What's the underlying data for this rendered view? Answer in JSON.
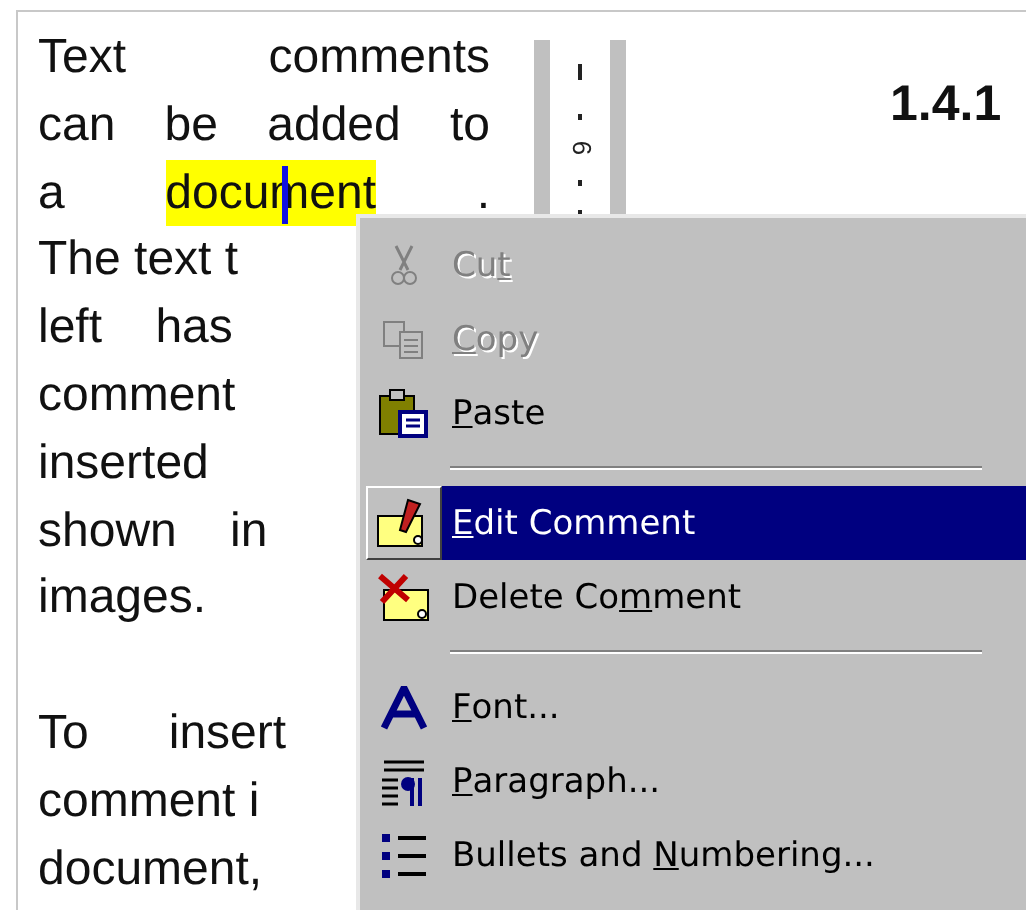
{
  "document": {
    "lines": [
      {
        "kind": "text",
        "parts": [
          {
            "text": "Text comments",
            "highlighted": false
          }
        ]
      },
      {
        "kind": "text",
        "parts": [
          {
            "text": "can be added to",
            "highlighted": false
          }
        ]
      },
      {
        "kind": "text",
        "parts": [
          {
            "text": "a",
            "highlighted": false
          },
          {
            "text": "document",
            "highlighted": true
          },
          {
            "text": ".",
            "highlighted": false
          }
        ]
      },
      {
        "kind": "text",
        "parts": [
          {
            "text": "The text t",
            "highlighted": false
          }
        ]
      },
      {
        "kind": "text",
        "parts": [
          {
            "text": "left    has",
            "highlighted": false
          }
        ]
      },
      {
        "kind": "text",
        "parts": [
          {
            "text": "comment",
            "highlighted": false
          }
        ]
      },
      {
        "kind": "text",
        "parts": [
          {
            "text": "inserted",
            "highlighted": false
          }
        ]
      },
      {
        "kind": "text",
        "parts": [
          {
            "text": "shown    in",
            "highlighted": false
          }
        ]
      },
      {
        "kind": "text",
        "parts": [
          {
            "text": "images.",
            "highlighted": false
          }
        ]
      },
      {
        "kind": "blank"
      },
      {
        "kind": "text",
        "parts": [
          {
            "text": "To      insert",
            "highlighted": false
          }
        ]
      },
      {
        "kind": "text",
        "parts": [
          {
            "text": "comment i",
            "highlighted": false
          }
        ]
      },
      {
        "kind": "text",
        "parts": [
          {
            "text": "document,",
            "highlighted": false
          }
        ]
      }
    ]
  },
  "ruler": {
    "label": "6"
  },
  "heading": "1.4.1",
  "context_menu": {
    "items": [
      {
        "kind": "item",
        "label": "Cut",
        "disabled": true,
        "selected": false
      },
      {
        "kind": "item",
        "label": "Copy",
        "disabled": true,
        "selected": false
      },
      {
        "kind": "item",
        "label": "Paste",
        "disabled": false,
        "selected": false
      },
      {
        "kind": "separator"
      },
      {
        "kind": "item",
        "label": "Edit Comment",
        "disabled": false,
        "selected": true
      },
      {
        "kind": "item",
        "label": "Delete Comment",
        "disabled": false,
        "selected": false
      },
      {
        "kind": "separator"
      },
      {
        "kind": "item",
        "label": "Font...",
        "disabled": false,
        "selected": false
      },
      {
        "kind": "item",
        "label": "Paragraph...",
        "disabled": false,
        "selected": false
      },
      {
        "kind": "item",
        "label": "Bullets and Numbering...",
        "disabled": false,
        "selected": false
      }
    ]
  }
}
